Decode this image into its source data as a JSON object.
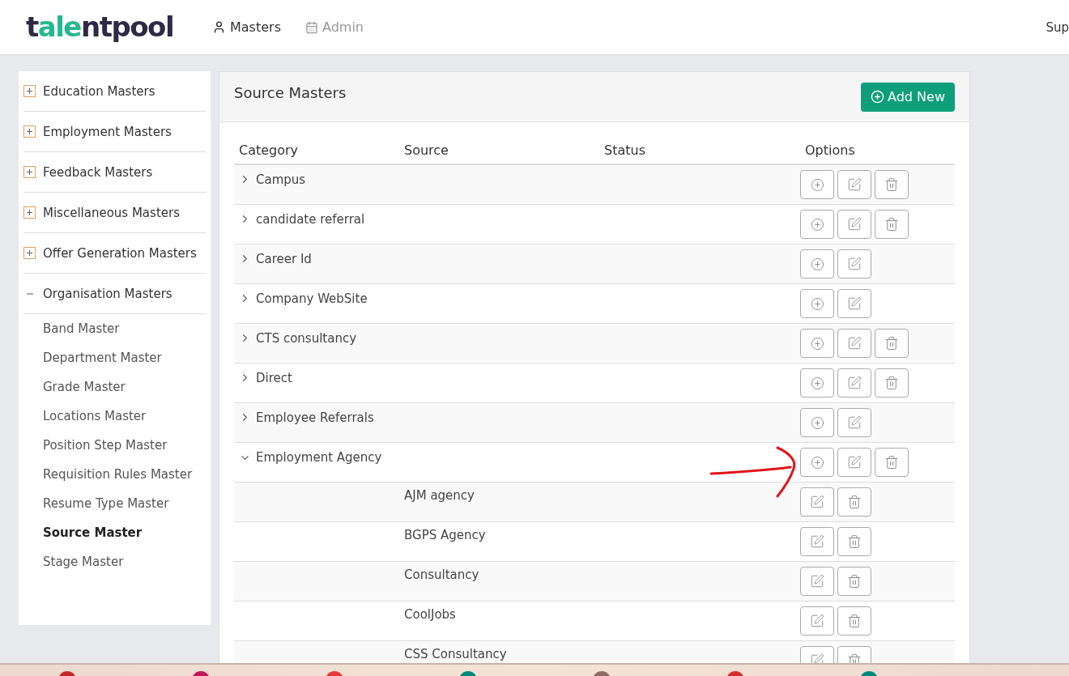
{
  "header": {
    "logo": "talentpool",
    "nav": [
      {
        "label": "Masters",
        "kind": "user",
        "selected": true
      },
      {
        "label": "Admin",
        "kind": "calendar",
        "selected": false
      }
    ],
    "user": "Sup"
  },
  "sidebar": {
    "groups": [
      {
        "label": "Education Masters",
        "expanded": false
      },
      {
        "label": "Employment Masters",
        "expanded": false
      },
      {
        "label": "Feedback Masters",
        "expanded": false
      },
      {
        "label": "Miscellaneous Masters",
        "expanded": false
      },
      {
        "label": "Offer Generation Masters",
        "expanded": false
      },
      {
        "label": "Organisation Masters",
        "expanded": true,
        "children": [
          {
            "label": "Band Master",
            "selected": false
          },
          {
            "label": "Department Master",
            "selected": false
          },
          {
            "label": "Grade Master",
            "selected": false
          },
          {
            "label": "Locations Master",
            "selected": false
          },
          {
            "label": "Position Step Master",
            "selected": false
          },
          {
            "label": "Requisition Rules Master",
            "selected": false
          },
          {
            "label": "Resume Type Master",
            "selected": false
          },
          {
            "label": "Source Master",
            "selected": true
          },
          {
            "label": "Stage Master",
            "selected": false
          }
        ]
      }
    ]
  },
  "panel": {
    "title": "Source Masters",
    "add_button": "Add New",
    "table": {
      "columns": [
        "Category",
        "Source",
        "Status",
        "Options"
      ],
      "rows": [
        {
          "kind": "category",
          "category": "Campus",
          "expanded": false,
          "actions": [
            {
              "kind": "add"
            },
            {
              "kind": "edit"
            },
            {
              "kind": "delete"
            }
          ]
        },
        {
          "kind": "category",
          "category": "candidate referral",
          "expanded": false,
          "actions": [
            {
              "kind": "add"
            },
            {
              "kind": "edit"
            },
            {
              "kind": "delete"
            }
          ]
        },
        {
          "kind": "category",
          "category": "Career Id",
          "expanded": false,
          "actions": [
            {
              "kind": "add"
            },
            {
              "kind": "edit"
            }
          ]
        },
        {
          "kind": "category",
          "category": "Company WebSite",
          "expanded": false,
          "actions": [
            {
              "kind": "add"
            },
            {
              "kind": "edit"
            }
          ]
        },
        {
          "kind": "category",
          "category": "CTS consultancy",
          "expanded": false,
          "actions": [
            {
              "kind": "add"
            },
            {
              "kind": "edit"
            },
            {
              "kind": "delete"
            }
          ]
        },
        {
          "kind": "category",
          "category": "Direct",
          "expanded": false,
          "actions": [
            {
              "kind": "add"
            },
            {
              "kind": "edit"
            },
            {
              "kind": "delete"
            }
          ]
        },
        {
          "kind": "category",
          "category": "Employee Referrals",
          "expanded": false,
          "actions": [
            {
              "kind": "add"
            },
            {
              "kind": "edit"
            }
          ]
        },
        {
          "kind": "category",
          "category": "Employment Agency",
          "expanded": true,
          "actions": [
            {
              "kind": "add"
            },
            {
              "kind": "edit"
            },
            {
              "kind": "delete"
            }
          ]
        },
        {
          "kind": "source",
          "source": "AJM agency",
          "actions": [
            {
              "kind": "edit"
            },
            {
              "kind": "delete"
            }
          ]
        },
        {
          "kind": "source",
          "source": "BGPS Agency",
          "actions": [
            {
              "kind": "edit"
            },
            {
              "kind": "delete"
            }
          ]
        },
        {
          "kind": "source",
          "source": "Consultancy",
          "actions": [
            {
              "kind": "edit"
            },
            {
              "kind": "delete"
            }
          ]
        },
        {
          "kind": "source",
          "source": "CoolJobs",
          "actions": [
            {
              "kind": "edit"
            },
            {
              "kind": "delete"
            }
          ]
        },
        {
          "kind": "source",
          "source": "CSS Consultancy",
          "actions": [
            {
              "kind": "edit"
            },
            {
              "kind": "delete"
            }
          ]
        }
      ]
    }
  },
  "taskbar": {
    "apps": [
      {
        "color": "#c62828"
      },
      {
        "color": "#c2185b"
      },
      {
        "color": "#e53935"
      },
      {
        "color": "#00897b"
      },
      {
        "color": "#8d6e63"
      },
      {
        "color": "#d32f2f"
      },
      {
        "color": "#00897b"
      }
    ]
  }
}
